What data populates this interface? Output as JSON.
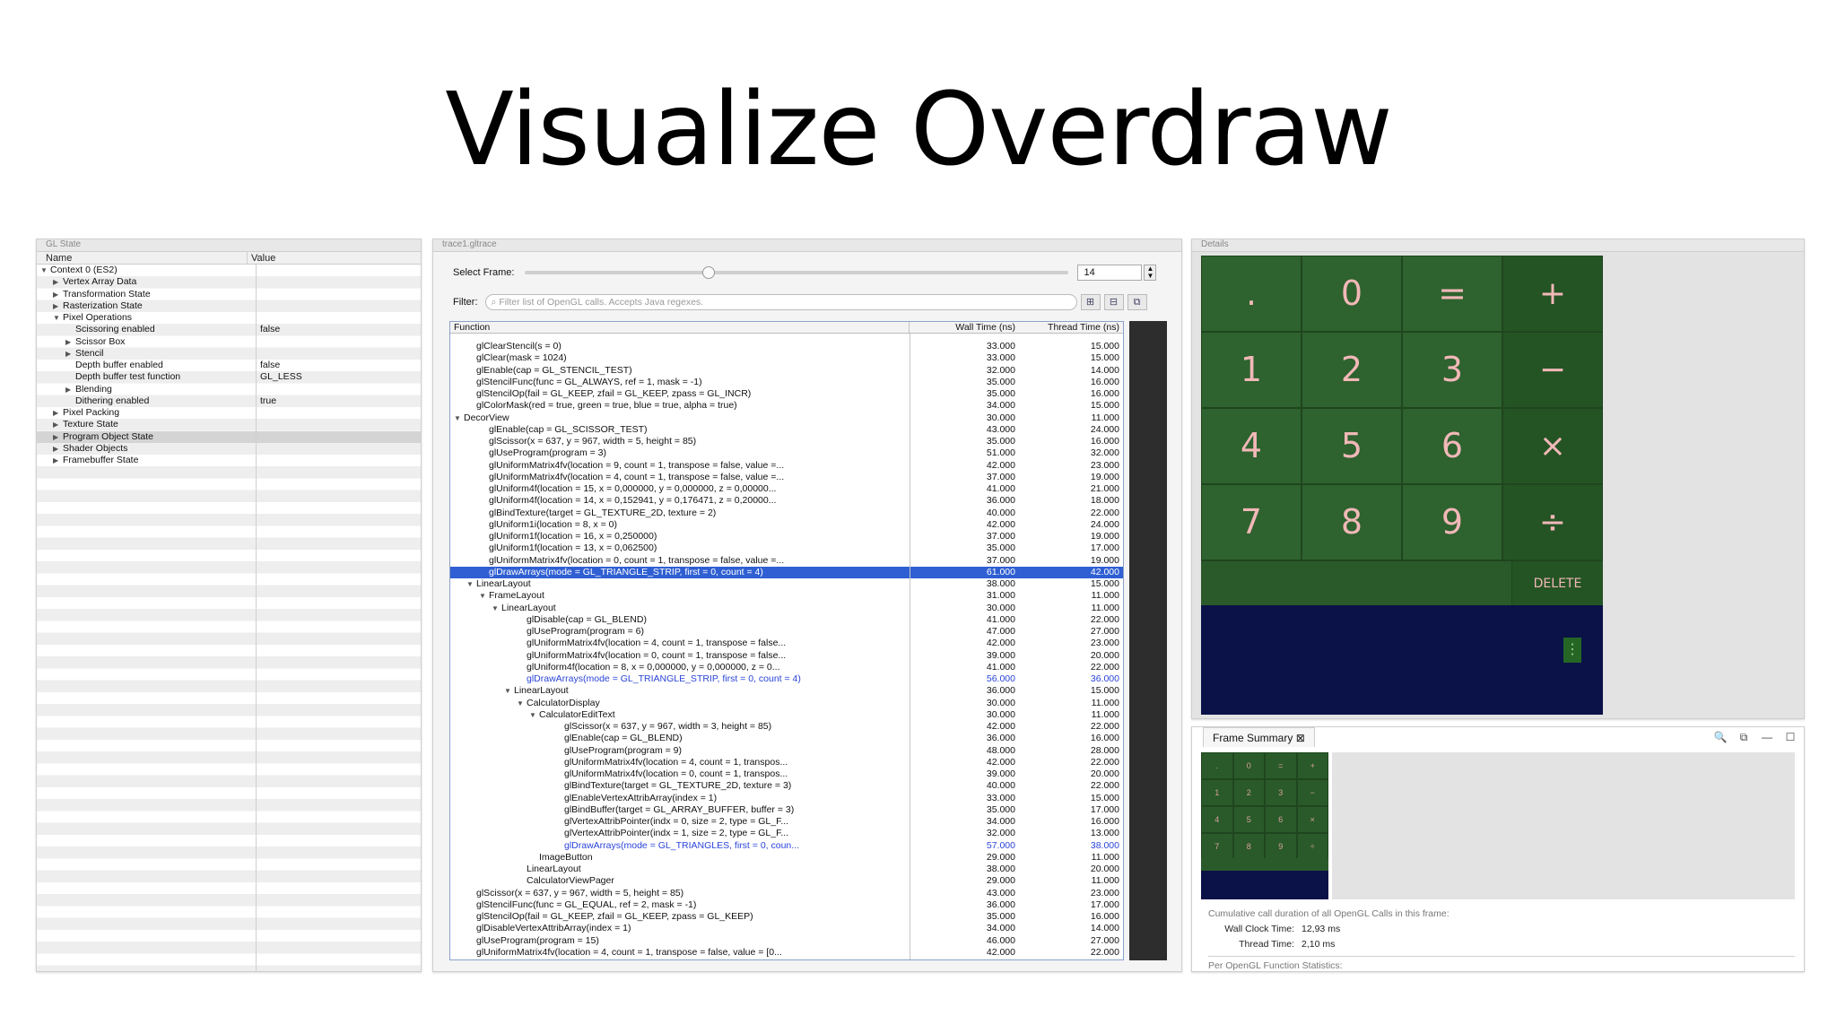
{
  "slide": {
    "title": "Visualize Overdraw"
  },
  "gl_state": {
    "tab_label": "GL State",
    "columns": {
      "name": "Name",
      "value": "Value"
    },
    "rows": [
      {
        "indent": 0,
        "twisty": "▼",
        "name": "Context 0 (ES2)",
        "value": ""
      },
      {
        "indent": 1,
        "twisty": "▶",
        "name": "Vertex Array Data",
        "value": ""
      },
      {
        "indent": 1,
        "twisty": "▶",
        "name": "Transformation State",
        "value": ""
      },
      {
        "indent": 1,
        "twisty": "▶",
        "name": "Rasterization State",
        "value": ""
      },
      {
        "indent": 1,
        "twisty": "▼",
        "name": "Pixel Operations",
        "value": ""
      },
      {
        "indent": 2,
        "twisty": "",
        "name": "Scissoring enabled",
        "value": "false"
      },
      {
        "indent": 2,
        "twisty": "▶",
        "name": "Scissor Box",
        "value": ""
      },
      {
        "indent": 2,
        "twisty": "▶",
        "name": "Stencil",
        "value": ""
      },
      {
        "indent": 2,
        "twisty": "",
        "name": "Depth buffer enabled",
        "value": "false"
      },
      {
        "indent": 2,
        "twisty": "",
        "name": "Depth buffer test function",
        "value": "GL_LESS"
      },
      {
        "indent": 2,
        "twisty": "▶",
        "name": "Blending",
        "value": ""
      },
      {
        "indent": 2,
        "twisty": "",
        "name": "Dithering enabled",
        "value": "true"
      },
      {
        "indent": 1,
        "twisty": "▶",
        "name": "Pixel Packing",
        "value": ""
      },
      {
        "indent": 1,
        "twisty": "▶",
        "name": "Texture State",
        "value": ""
      },
      {
        "indent": 1,
        "twisty": "▶",
        "name": "Program Object State",
        "value": "",
        "selected": true
      },
      {
        "indent": 1,
        "twisty": "▶",
        "name": "Shader Objects",
        "value": ""
      },
      {
        "indent": 1,
        "twisty": "▶",
        "name": "Framebuffer State",
        "value": ""
      }
    ]
  },
  "trace": {
    "tab_label": "trace1.gltrace",
    "select_frame_label": "Select Frame:",
    "frame_value": "14",
    "filter_label": "Filter:",
    "filter_placeholder": "Filter list of OpenGL calls. Accepts Java regexes.",
    "columns": {
      "function": "Function",
      "wall": "Wall Time (ns)",
      "thread": "Thread Time (ns)"
    },
    "rows": [
      {
        "indent": 1,
        "twisty": "",
        "fn": "glClearStencil(s = 0)",
        "wall": "33.000",
        "thread": "15.000"
      },
      {
        "indent": 1,
        "twisty": "",
        "fn": "glClear(mask = 1024)",
        "wall": "33.000",
        "thread": "15.000"
      },
      {
        "indent": 1,
        "twisty": "",
        "fn": "glEnable(cap = GL_STENCIL_TEST)",
        "wall": "32.000",
        "thread": "14.000"
      },
      {
        "indent": 1,
        "twisty": "",
        "fn": "glStencilFunc(func = GL_ALWAYS, ref = 1, mask = -1)",
        "wall": "35.000",
        "thread": "16.000"
      },
      {
        "indent": 1,
        "twisty": "",
        "fn": "glStencilOp(fail = GL_KEEP, zfail = GL_KEEP, zpass = GL_INCR)",
        "wall": "35.000",
        "thread": "16.000"
      },
      {
        "indent": 1,
        "twisty": "",
        "fn": "glColorMask(red = true, green = true, blue = true, alpha = true)",
        "wall": "34.000",
        "thread": "15.000"
      },
      {
        "indent": 0,
        "twisty": "▼",
        "fn": "DecorView",
        "wall": "30.000",
        "thread": "11.000"
      },
      {
        "indent": 2,
        "twisty": "",
        "fn": "glEnable(cap = GL_SCISSOR_TEST)",
        "wall": "43.000",
        "thread": "24.000"
      },
      {
        "indent": 2,
        "twisty": "",
        "fn": "glScissor(x = 637, y = 967, width = 5, height = 85)",
        "wall": "35.000",
        "thread": "16.000"
      },
      {
        "indent": 2,
        "twisty": "",
        "fn": "glUseProgram(program = 3)",
        "wall": "51.000",
        "thread": "32.000"
      },
      {
        "indent": 2,
        "twisty": "",
        "fn": "glUniformMatrix4fv(location = 9, count = 1, transpose = false, value =...",
        "wall": "42.000",
        "thread": "23.000"
      },
      {
        "indent": 2,
        "twisty": "",
        "fn": "glUniformMatrix4fv(location = 4, count = 1, transpose = false, value =...",
        "wall": "37.000",
        "thread": "19.000"
      },
      {
        "indent": 2,
        "twisty": "",
        "fn": "glUniform4f(location = 15, x = 0,000000, y = 0,000000, z = 0,00000...",
        "wall": "41.000",
        "thread": "21.000"
      },
      {
        "indent": 2,
        "twisty": "",
        "fn": "glUniform4f(location = 14, x = 0,152941, y = 0,176471, z = 0,20000...",
        "wall": "36.000",
        "thread": "18.000"
      },
      {
        "indent": 2,
        "twisty": "",
        "fn": "glBindTexture(target = GL_TEXTURE_2D, texture = 2)",
        "wall": "40.000",
        "thread": "22.000"
      },
      {
        "indent": 2,
        "twisty": "",
        "fn": "glUniform1i(location = 8, x = 0)",
        "wall": "42.000",
        "thread": "24.000"
      },
      {
        "indent": 2,
        "twisty": "",
        "fn": "glUniform1f(location = 16, x = 0,250000)",
        "wall": "37.000",
        "thread": "19.000"
      },
      {
        "indent": 2,
        "twisty": "",
        "fn": "glUniform1f(location = 13, x = 0,062500)",
        "wall": "35.000",
        "thread": "17.000"
      },
      {
        "indent": 2,
        "twisty": "",
        "fn": "glUniformMatrix4fv(location = 0, count = 1, transpose = false, value =...",
        "wall": "37.000",
        "thread": "19.000"
      },
      {
        "indent": 2,
        "twisty": "",
        "fn": "glDrawArrays(mode = GL_TRIANGLE_STRIP, first = 0, count = 4)",
        "wall": "61.000",
        "thread": "42.000",
        "selected": true
      },
      {
        "indent": 1,
        "twisty": "▼",
        "fn": "LinearLayout",
        "wall": "38.000",
        "thread": "15.000"
      },
      {
        "indent": 2,
        "twisty": "▼",
        "fn": "FrameLayout",
        "wall": "31.000",
        "thread": "11.000"
      },
      {
        "indent": 3,
        "twisty": "▼",
        "fn": "LinearLayout",
        "wall": "30.000",
        "thread": "11.000"
      },
      {
        "indent": 5,
        "twisty": "",
        "fn": "glDisable(cap = GL_BLEND)",
        "wall": "41.000",
        "thread": "22.000"
      },
      {
        "indent": 5,
        "twisty": "",
        "fn": "glUseProgram(program = 6)",
        "wall": "47.000",
        "thread": "27.000"
      },
      {
        "indent": 5,
        "twisty": "",
        "fn": "glUniformMatrix4fv(location = 4, count = 1, transpose = false...",
        "wall": "42.000",
        "thread": "23.000"
      },
      {
        "indent": 5,
        "twisty": "",
        "fn": "glUniformMatrix4fv(location = 0, count = 1, transpose = false...",
        "wall": "39.000",
        "thread": "20.000"
      },
      {
        "indent": 5,
        "twisty": "",
        "fn": "glUniform4f(location = 8, x = 0,000000, y = 0,000000, z = 0...",
        "wall": "41.000",
        "thread": "22.000"
      },
      {
        "indent": 5,
        "twisty": "",
        "fn": "glDrawArrays(mode = GL_TRIANGLE_STRIP, first = 0, count = 4)",
        "wall": "56.000",
        "thread": "36.000",
        "blue": true
      },
      {
        "indent": 4,
        "twisty": "▼",
        "fn": "LinearLayout",
        "wall": "36.000",
        "thread": "15.000"
      },
      {
        "indent": 5,
        "twisty": "▼",
        "fn": "CalculatorDisplay",
        "wall": "30.000",
        "thread": "11.000"
      },
      {
        "indent": 6,
        "twisty": "▼",
        "fn": "CalculatorEditText",
        "wall": "30.000",
        "thread": "11.000"
      },
      {
        "indent": 8,
        "twisty": "",
        "fn": "glScissor(x = 637, y = 967, width = 3, height = 85)",
        "wall": "42.000",
        "thread": "22.000"
      },
      {
        "indent": 8,
        "twisty": "",
        "fn": "glEnable(cap = GL_BLEND)",
        "wall": "36.000",
        "thread": "16.000"
      },
      {
        "indent": 8,
        "twisty": "",
        "fn": "glUseProgram(program = 9)",
        "wall": "48.000",
        "thread": "28.000"
      },
      {
        "indent": 8,
        "twisty": "",
        "fn": "glUniformMatrix4fv(location = 4, count = 1, transpos...",
        "wall": "42.000",
        "thread": "22.000"
      },
      {
        "indent": 8,
        "twisty": "",
        "fn": "glUniformMatrix4fv(location = 0, count = 1, transpos...",
        "wall": "39.000",
        "thread": "20.000"
      },
      {
        "indent": 8,
        "twisty": "",
        "fn": "glBindTexture(target = GL_TEXTURE_2D, texture = 3)",
        "wall": "40.000",
        "thread": "22.000"
      },
      {
        "indent": 8,
        "twisty": "",
        "fn": "glEnableVertexAttribArray(index = 1)",
        "wall": "33.000",
        "thread": "15.000"
      },
      {
        "indent": 8,
        "twisty": "",
        "fn": "glBindBuffer(target = GL_ARRAY_BUFFER, buffer = 3)",
        "wall": "35.000",
        "thread": "17.000"
      },
      {
        "indent": 8,
        "twisty": "",
        "fn": "glVertexAttribPointer(indx = 0, size = 2, type = GL_F...",
        "wall": "34.000",
        "thread": "16.000"
      },
      {
        "indent": 8,
        "twisty": "",
        "fn": "glVertexAttribPointer(indx = 1, size = 2, type = GL_F...",
        "wall": "32.000",
        "thread": "13.000"
      },
      {
        "indent": 8,
        "twisty": "",
        "fn": "glDrawArrays(mode = GL_TRIANGLES, first = 0, coun...",
        "wall": "57.000",
        "thread": "38.000",
        "blue": true
      },
      {
        "indent": 6,
        "twisty": "",
        "fn": "ImageButton",
        "wall": "29.000",
        "thread": "11.000"
      },
      {
        "indent": 5,
        "twisty": "",
        "fn": "LinearLayout",
        "wall": "38.000",
        "thread": "20.000"
      },
      {
        "indent": 5,
        "twisty": "",
        "fn": "CalculatorViewPager",
        "wall": "29.000",
        "thread": "11.000"
      },
      {
        "indent": 1,
        "twisty": "",
        "fn": "glScissor(x = 637, y = 967, width = 5, height = 85)",
        "wall": "43.000",
        "thread": "23.000"
      },
      {
        "indent": 1,
        "twisty": "",
        "fn": "glStencilFunc(func = GL_EQUAL, ref = 2, mask = -1)",
        "wall": "36.000",
        "thread": "17.000"
      },
      {
        "indent": 1,
        "twisty": "",
        "fn": "glStencilOp(fail = GL_KEEP, zfail = GL_KEEP, zpass = GL_KEEP)",
        "wall": "35.000",
        "thread": "16.000"
      },
      {
        "indent": 1,
        "twisty": "",
        "fn": "glDisableVertexAttribArray(index = 1)",
        "wall": "34.000",
        "thread": "14.000"
      },
      {
        "indent": 1,
        "twisty": "",
        "fn": "glUseProgram(program = 15)",
        "wall": "46.000",
        "thread": "27.000"
      },
      {
        "indent": 1,
        "twisty": "",
        "fn": "glUniformMatrix4fv(location = 4, count = 1, transpose = false, value = [0...",
        "wall": "42.000",
        "thread": "22.000"
      }
    ]
  },
  "details": {
    "tab_label": "Details",
    "calculator": {
      "keys": [
        {
          "label": ".",
          "type": "digit",
          "mirrored": false
        },
        {
          "label": "0",
          "type": "digit",
          "mirrored": false
        },
        {
          "label": "=",
          "type": "digit",
          "mirrored": false
        },
        {
          "label": "+",
          "type": "op",
          "mirrored": false
        },
        {
          "label": "1",
          "type": "digit",
          "mirrored": true
        },
        {
          "label": "2",
          "type": "digit",
          "mirrored": true
        },
        {
          "label": "3",
          "type": "digit",
          "mirrored": false
        },
        {
          "label": "−",
          "type": "op",
          "mirrored": false
        },
        {
          "label": "4",
          "type": "digit",
          "mirrored": true
        },
        {
          "label": "5",
          "type": "digit",
          "mirrored": true
        },
        {
          "label": "6",
          "type": "digit",
          "mirrored": true
        },
        {
          "label": "×",
          "type": "op",
          "mirrored": false
        },
        {
          "label": "7",
          "type": "digit",
          "mirrored": true
        },
        {
          "label": "8",
          "type": "digit",
          "mirrored": false
        },
        {
          "label": "9",
          "type": "digit",
          "mirrored": true
        },
        {
          "label": "÷",
          "type": "op",
          "mirrored": false
        }
      ],
      "delete_label": "DELETE",
      "overflow_icon": "⋮"
    }
  },
  "frame_summary": {
    "tab_label": "Frame Summary",
    "tab_close_icon": "⊠",
    "toolbar_icons": [
      "🔍",
      "⧉",
      "—",
      "☐"
    ],
    "thumb_keys": [
      ".",
      "0",
      "=",
      "+",
      "1",
      "2",
      "3",
      "−",
      "4",
      "5",
      "6",
      "×",
      "7",
      "8",
      "9",
      "÷"
    ],
    "cumulative_text": "Cumulative call duration of all OpenGL Calls in this frame:",
    "wall_clock_label": "Wall Clock Time:",
    "wall_clock_value": "12,93 ms",
    "thread_time_label": "Thread Time:",
    "thread_time_value": "2,10 ms",
    "per_function_text": "Per OpenGL Function Statistics:"
  },
  "colors": {
    "calculator_key_bg": "#2e622e",
    "calculator_key_text": "#f2b8b8",
    "display_bg": "#0a1248",
    "selection_blue": "#2f5fd2",
    "draw_call_blue": "#2a44d8"
  }
}
